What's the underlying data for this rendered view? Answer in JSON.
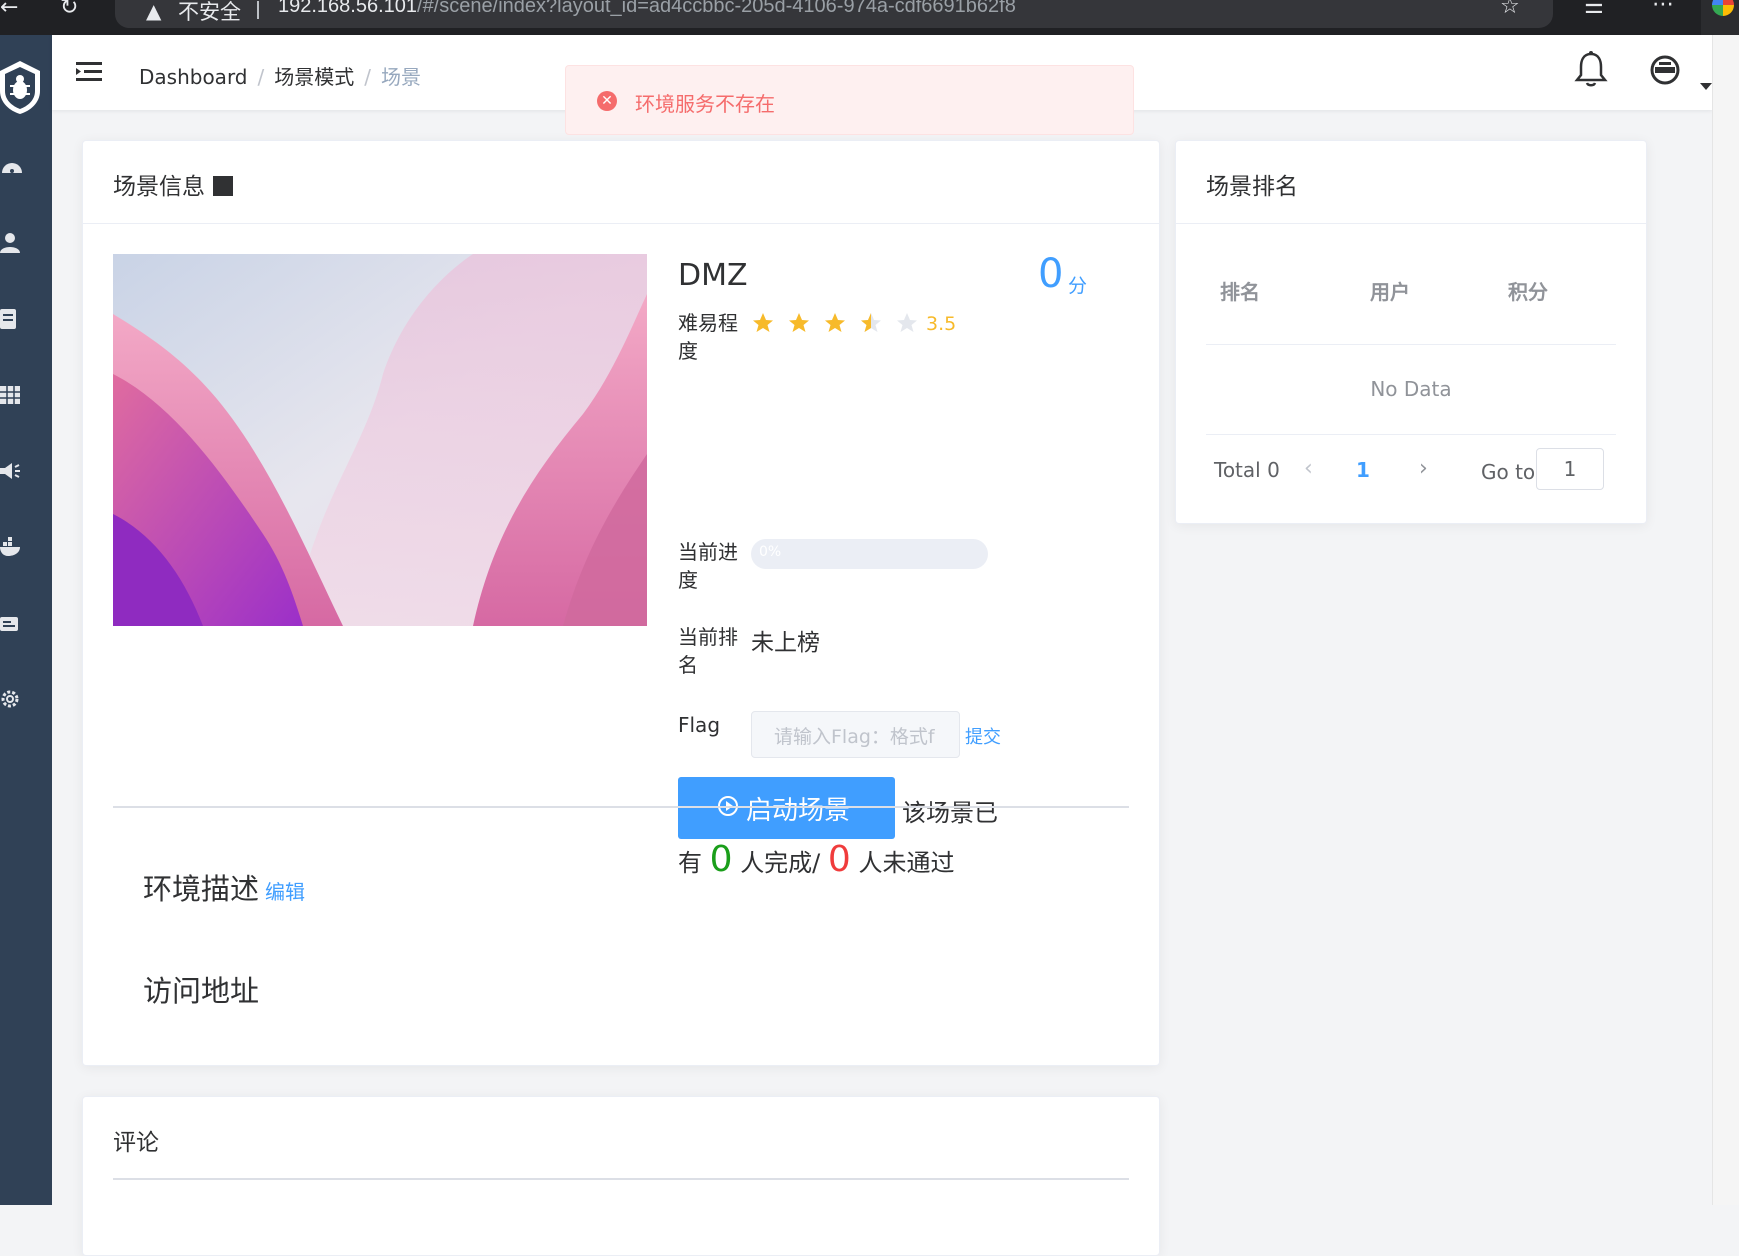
{
  "browser": {
    "security_label": "不安全",
    "url_host": "192.168.56.101",
    "url_path": "/#/scene/index?layout_id=ad4ccbbc-205d-4106-974a-cdf6691b62f8"
  },
  "sidebar": {
    "items": [
      "dashboard-icon",
      "user-icon",
      "document-icon",
      "table-icon",
      "announcement-icon",
      "docker-icon",
      "message-icon",
      "settings-icon"
    ],
    "accent": "#304156"
  },
  "breadcrumb": {
    "items": [
      "Dashboard",
      "场景模式"
    ],
    "current": "场景"
  },
  "alert": {
    "message": "环境服务不存在",
    "color": "#f56c6c"
  },
  "scene": {
    "card_title": "场景信息",
    "name": "DMZ",
    "score": "0",
    "score_unit": "分",
    "difficulty_label": "难易程度",
    "difficulty_value": 3.5,
    "difficulty_text": "3.5",
    "progress_label": "当前进度",
    "progress_value": 0,
    "progress_text": "0%",
    "rank_label": "当前排名",
    "rank_value": "未上榜",
    "flag_label": "Flag",
    "flag_placeholder": "请输入Flag：格式f",
    "submit_label": "提交",
    "start_label": "启动场景",
    "stat_prefix_1": "该场景已",
    "stat_prefix_2": "有",
    "completed_count": "0",
    "completed_suffix": "人完成/",
    "failed_count": "0",
    "failed_suffix": "人未通过",
    "env_desc_label": "环境描述",
    "edit_label": "编辑",
    "access_label": "访问地址"
  },
  "ranking": {
    "card_title": "场景排名",
    "columns": [
      "排名",
      "用户",
      "积分"
    ],
    "empty_text": "No Data",
    "total_text": "Total 0",
    "current_page": "1",
    "goto_label": "Go to",
    "goto_value": "1"
  },
  "comments": {
    "card_title": "评论"
  }
}
